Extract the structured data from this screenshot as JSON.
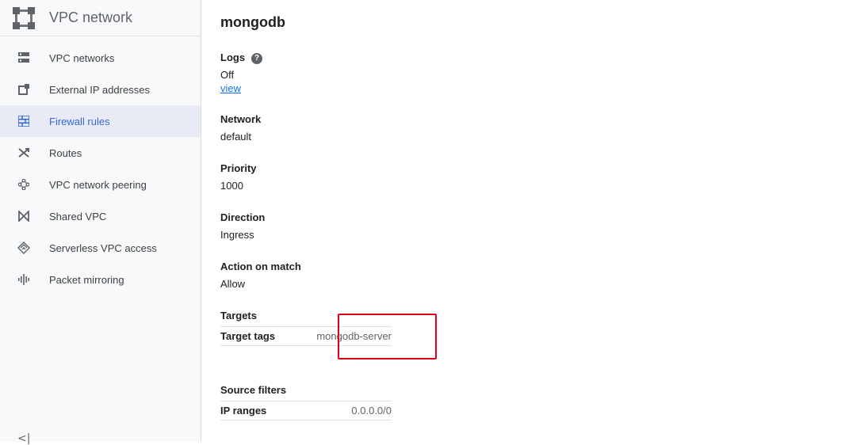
{
  "sidebar": {
    "title": "VPC network",
    "items": [
      {
        "label": "VPC networks",
        "icon": "vpc-networks-icon"
      },
      {
        "label": "External IP addresses",
        "icon": "external-ip-icon"
      },
      {
        "label": "Firewall rules",
        "icon": "firewall-icon",
        "active": true
      },
      {
        "label": "Routes",
        "icon": "routes-icon"
      },
      {
        "label": "VPC network peering",
        "icon": "peering-icon"
      },
      {
        "label": "Shared VPC",
        "icon": "shared-vpc-icon"
      },
      {
        "label": "Serverless VPC access",
        "icon": "serverless-icon"
      },
      {
        "label": "Packet mirroring",
        "icon": "packet-mirroring-icon"
      }
    ],
    "collapse_glyph": "<|"
  },
  "main": {
    "title": "mongodb",
    "logs": {
      "label": "Logs",
      "help": "?",
      "value": "Off",
      "link": "view"
    },
    "network": {
      "label": "Network",
      "value": "default"
    },
    "priority": {
      "label": "Priority",
      "value": "1000"
    },
    "direction": {
      "label": "Direction",
      "value": "Ingress"
    },
    "action": {
      "label": "Action on match",
      "value": "Allow"
    },
    "targets": {
      "label": "Targets",
      "key": "Target tags",
      "value": "mongodb-server"
    },
    "source_filters": {
      "label": "Source filters",
      "key": "IP ranges",
      "value": "0.0.0.0/0"
    }
  },
  "colors": {
    "accent": "#3367d6",
    "active_bg": "#e8eaf6",
    "highlight": "#e2001a",
    "link": "#1a73e8"
  }
}
